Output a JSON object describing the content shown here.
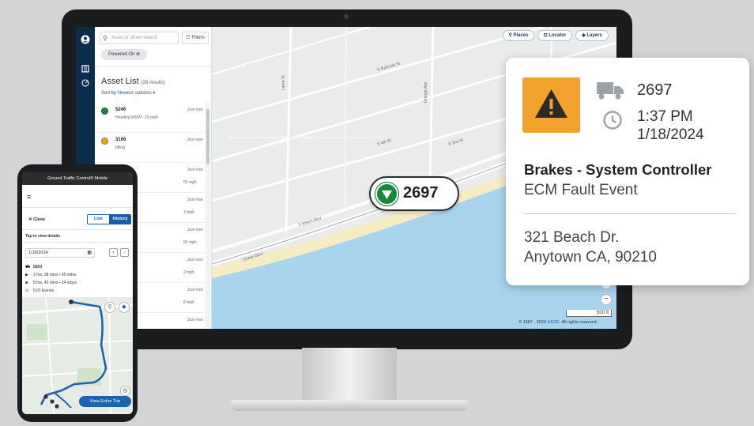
{
  "desktop": {
    "search": {
      "placeholder": "Asset or driver search"
    },
    "filters_label": "Filters",
    "powered_chip": "Powered On",
    "collapse_glyph": "«",
    "asset_list": {
      "title": "Asset List",
      "count": "(28 results)",
      "sort_prefix": "Sort by",
      "sort_value": "Newest updates",
      "rows": [
        {
          "id": "5246",
          "sub": "Heading WSW - 15 mph",
          "time": "Just now",
          "status": "moving"
        },
        {
          "id": "3106",
          "sub": "Idling",
          "time": "Just now",
          "status": "idle"
        },
        {
          "id": "",
          "sub": "50 mph",
          "time": "Just now",
          "status": "hidden"
        },
        {
          "id": "",
          "sub": "7 mph",
          "time": "Just now",
          "status": "hidden"
        },
        {
          "id": "",
          "sub": "50 mph",
          "time": "Just now",
          "status": "hidden"
        },
        {
          "id": "",
          "sub": "2 mph",
          "time": "Just now",
          "status": "hidden"
        },
        {
          "id": "",
          "sub": "8 mph",
          "time": "Just now",
          "status": "hidden"
        },
        {
          "id": "",
          "sub": "",
          "time": "Just now",
          "status": "hidden"
        }
      ]
    },
    "map": {
      "buttons": {
        "places": "Places",
        "locator": "Locator",
        "layers": "Layers"
      },
      "zoom_in": "+",
      "zoom_out": "−",
      "scale": "500 ft",
      "copyright_year": "© 1987 - 2024",
      "copyright_brand": "HERE",
      "copyright_rights": ". All rights reserved.",
      "streets": [
        "E Railroad St",
        "E 2nd St",
        "E 3rd St",
        "E 4th St",
        "E 5th St",
        "S Beach Blvd",
        "E Beach Blvd",
        "Ocean Blvd",
        "Lamp St",
        "Orange Ave"
      ]
    },
    "marker": {
      "unit": "2697"
    }
  },
  "alert_card": {
    "unit": "2697",
    "time": "1:37 PM",
    "date": "1/18/2024",
    "fault": "Brakes - System Controller",
    "event": "ECM Fault Event",
    "address_line1": "321 Beach Dr.",
    "address_line2": "Anytown CA, 90210"
  },
  "mobile": {
    "app_title": "Ground Traffic Control® Mobile",
    "close": "✕ Close",
    "toggle": {
      "live": "Live",
      "history": "History"
    },
    "tap_hint": "Tap to view details",
    "date": "1/18/2024",
    "prev": "‹",
    "next": "›",
    "unit": "5503",
    "stats": {
      "driving": "3 hrs, 38 mins • 95 miles",
      "stopped": "5 hrs, 42 mins • 24 stops",
      "io": "0 IO Events"
    },
    "view_trip": "View Entire Trip"
  },
  "colors": {
    "nav": "#0c2c4d",
    "accent_blue": "#1a6ec2",
    "alert_orange": "#f2a22c",
    "moving_green": "#168a3c",
    "water": "#a9d4ee",
    "sand": "#f5ecc4"
  }
}
